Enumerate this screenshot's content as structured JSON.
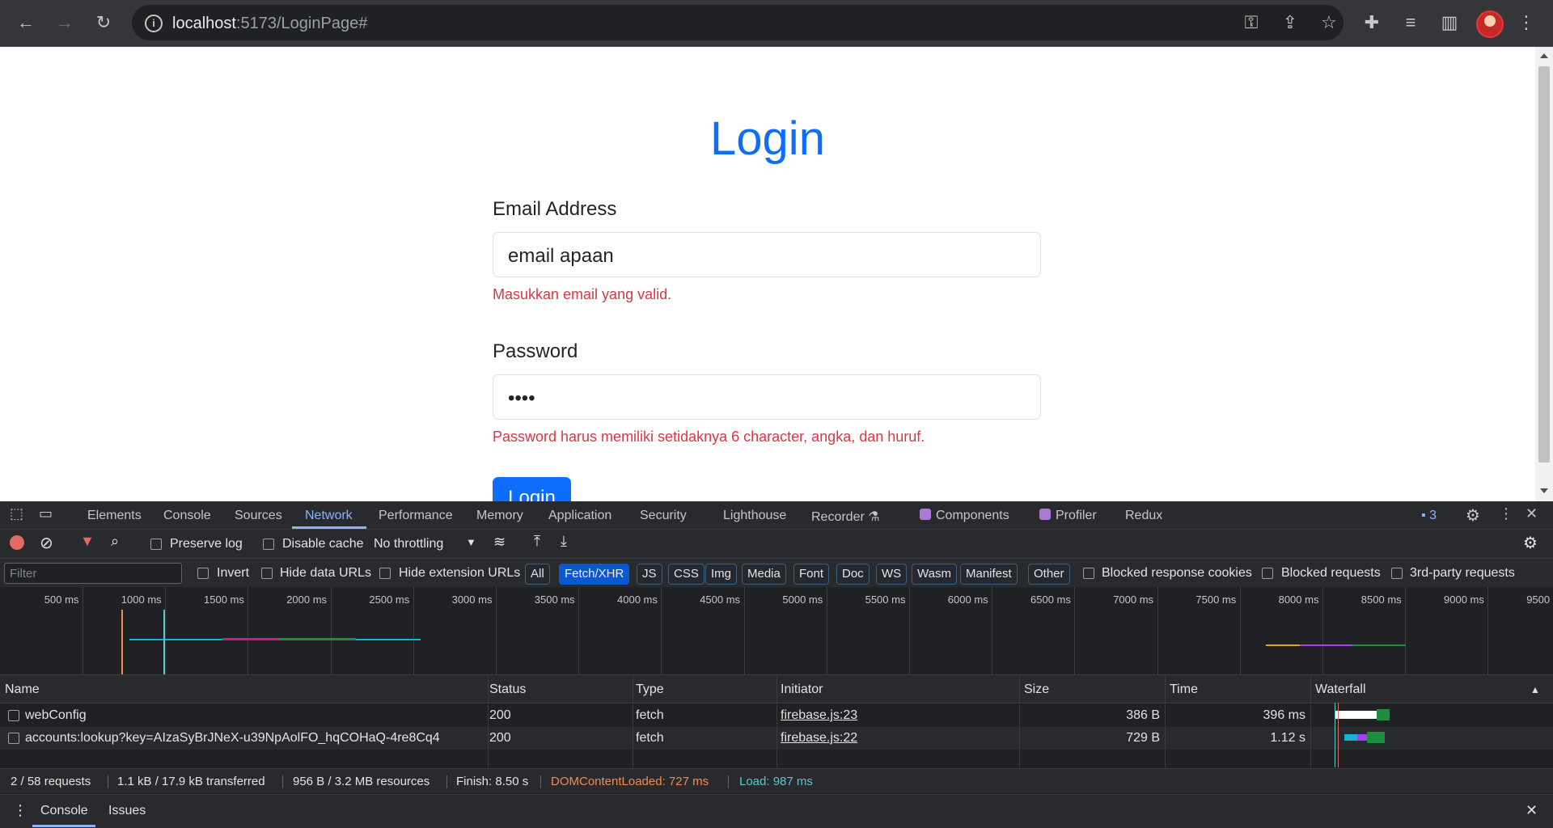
{
  "browser": {
    "url_host": "localhost",
    "url_path": ":5173/LoginPage#"
  },
  "page": {
    "title": "Login",
    "email_label": "Email Address",
    "email_value": "email apaan",
    "email_error": "Masukkan email yang valid.",
    "password_label": "Password",
    "password_value": "••••",
    "password_error": "Password harus memiliki setidaknya 6 character, angka, dan huruf.",
    "submit_label": "Login"
  },
  "devtools": {
    "tabs": [
      "Elements",
      "Console",
      "Sources",
      "Network",
      "Performance",
      "Memory",
      "Application",
      "Security",
      "Lighthouse",
      "Recorder",
      "Components",
      "Profiler",
      "Redux"
    ],
    "active_tab": "Network",
    "issues_count": "3",
    "toolbar": {
      "preserve_log": "Preserve log",
      "disable_cache": "Disable cache",
      "throttling": "No throttling"
    },
    "filter": {
      "placeholder": "Filter",
      "invert": "Invert",
      "hide_data_urls": "Hide data URLs",
      "hide_extension_urls": "Hide extension URLs",
      "types": [
        "All",
        "Fetch/XHR",
        "JS",
        "CSS",
        "Img",
        "Media",
        "Font",
        "Doc",
        "WS",
        "Wasm",
        "Manifest",
        "Other"
      ],
      "selected_type": "Fetch/XHR",
      "blocked_response_cookies": "Blocked response cookies",
      "blocked_requests": "Blocked requests",
      "third_party": "3rd-party requests"
    },
    "overview_ticks": [
      "500 ms",
      "1000 ms",
      "1500 ms",
      "2000 ms",
      "2500 ms",
      "3000 ms",
      "3500 ms",
      "4000 ms",
      "4500 ms",
      "5000 ms",
      "5500 ms",
      "6000 ms",
      "6500 ms",
      "7000 ms",
      "7500 ms",
      "8000 ms",
      "8500 ms",
      "9000 ms",
      "9500"
    ],
    "columns": [
      "Name",
      "Status",
      "Type",
      "Initiator",
      "Size",
      "Time",
      "Waterfall"
    ],
    "requests": [
      {
        "name": "webConfig",
        "status": "200",
        "type": "fetch",
        "initiator": "firebase.js:23",
        "size": "386 B",
        "time": "396 ms"
      },
      {
        "name": "accounts:lookup?key=AIzaSyBrJNeX-u39NpAolFO_hqCOHaQ-4re8Cq4",
        "status": "200",
        "type": "fetch",
        "initiator": "firebase.js:22",
        "size": "729 B",
        "time": "1.12 s"
      }
    ],
    "status": {
      "requests": "2 / 58 requests",
      "transferred": "1.1 kB / 17.9 kB transferred",
      "resources": "956 B / 3.2 MB resources",
      "finish": "Finish: 8.50 s",
      "dom_content_loaded": "DOMContentLoaded: 727 ms",
      "load": "Load: 987 ms"
    },
    "drawer_tabs": [
      "Console",
      "Issues"
    ],
    "colors": {
      "dcl": "#f28b54",
      "load": "#5bc7c7",
      "accent": "#8ab4f8"
    }
  }
}
